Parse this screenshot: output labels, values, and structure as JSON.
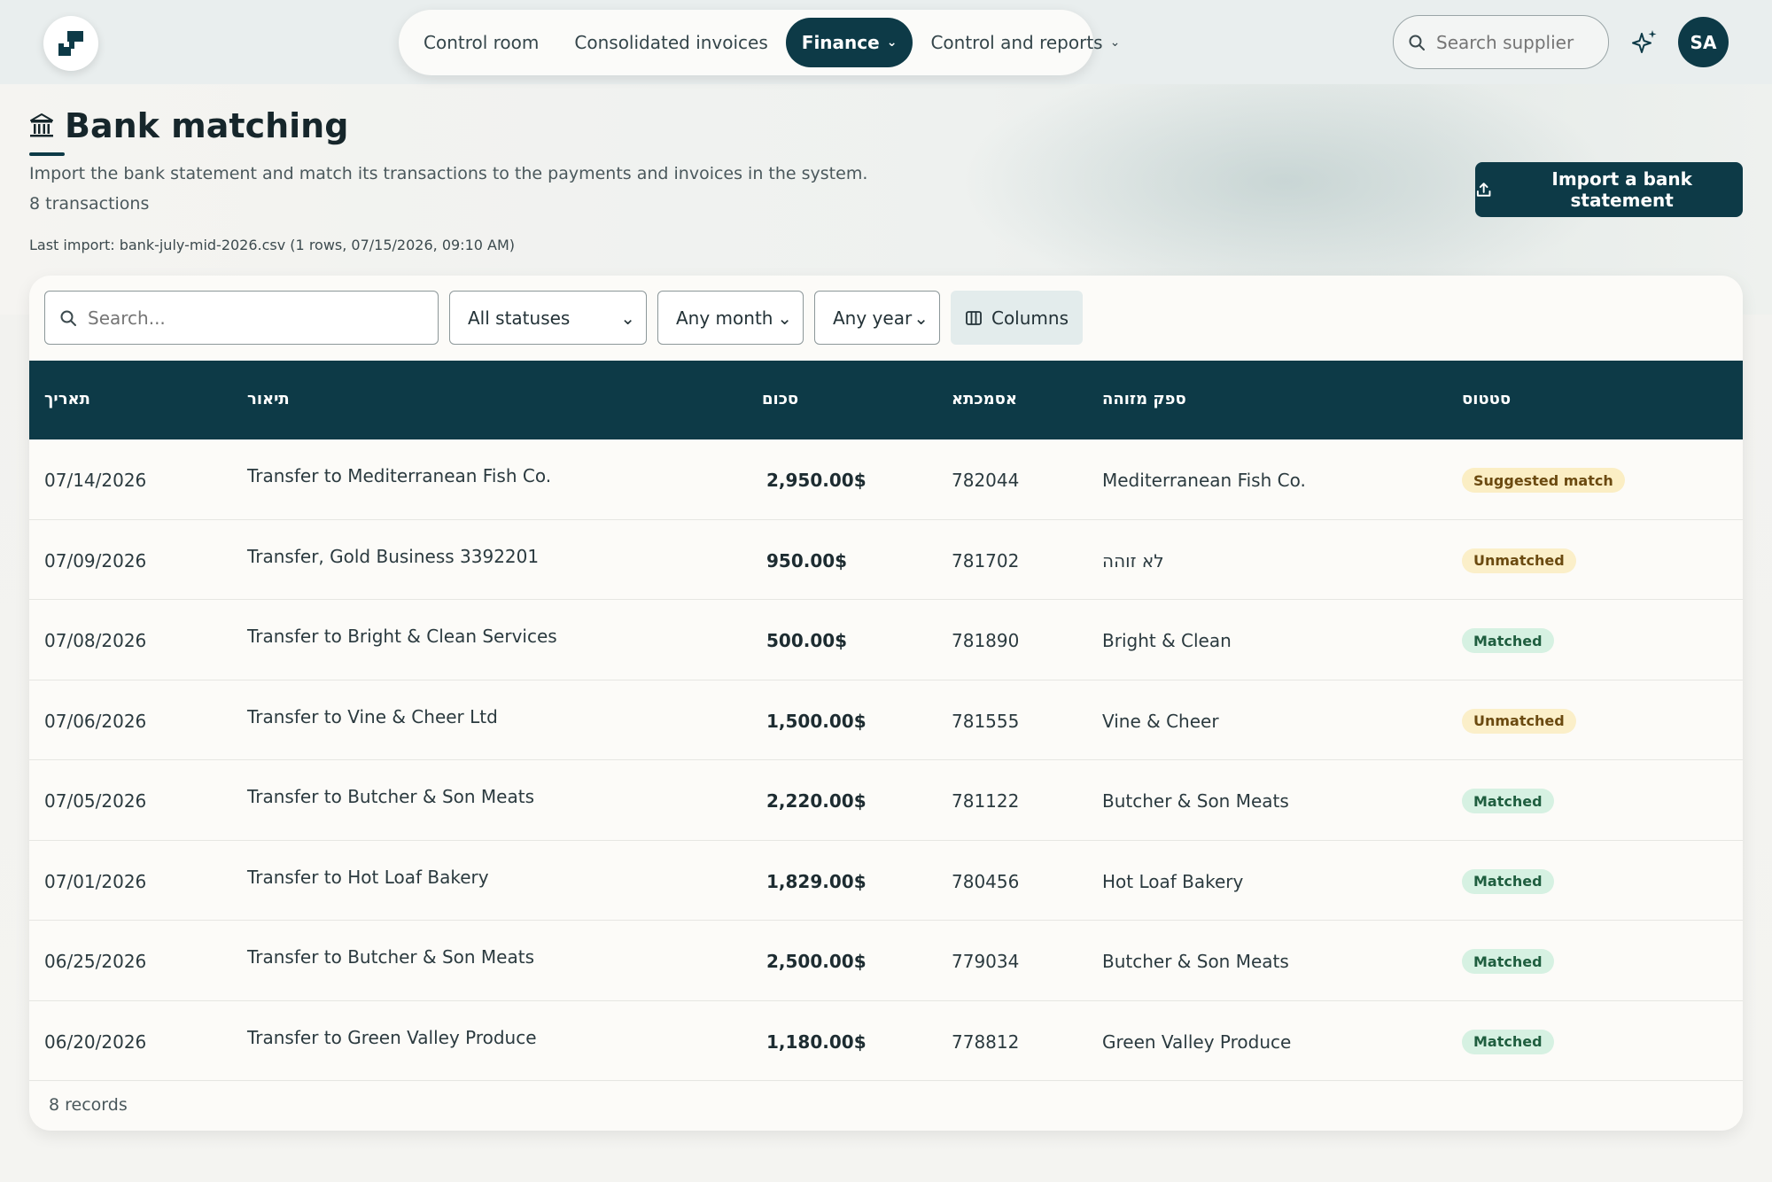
{
  "nav": {
    "items": [
      {
        "label": "Control room"
      },
      {
        "label": "Consolidated invoices"
      },
      {
        "label": "Finance"
      },
      {
        "label": "Control and reports"
      }
    ]
  },
  "header": {
    "search_placeholder": "Search supplier",
    "avatar_initials": "SA"
  },
  "page": {
    "title": "Bank matching",
    "subtitle": "Import the bank statement and match its transactions to the payments and invoices in the system.",
    "transaction_count": "8 transactions",
    "last_import": "Last import: bank-july-mid-2026.csv (1 rows, 07/15/2026, 09:10 AM)",
    "import_button": "Import a bank statement"
  },
  "filters": {
    "search_placeholder": "Search...",
    "status": "All statuses",
    "month": "Any month",
    "year": "Any year",
    "columns_label": "Columns"
  },
  "table": {
    "headers": {
      "date": "תאריך",
      "description": "תיאור",
      "amount": "סכום",
      "reference": "אסמכתא",
      "supplier": "ספק מזוהה",
      "status": "סטטוס"
    },
    "rows": [
      {
        "date": "07/14/2026",
        "description": "Transfer to Mediterranean Fish Co.",
        "amount": "2,950.00$",
        "reference": "782044",
        "supplier": "Mediterranean Fish Co.",
        "status": "Suggested match",
        "status_type": "suggested"
      },
      {
        "date": "07/09/2026",
        "description": "Transfer, Gold Business 3392201",
        "amount": "950.00$",
        "reference": "781702",
        "supplier": "לא זוהה",
        "status": "Unmatched",
        "status_type": "unmatched"
      },
      {
        "date": "07/08/2026",
        "description": "Transfer to Bright & Clean Services",
        "amount": "500.00$",
        "reference": "781890",
        "supplier": "Bright & Clean",
        "status": "Matched",
        "status_type": "matched"
      },
      {
        "date": "07/06/2026",
        "description": "Transfer to Vine & Cheer Ltd",
        "amount": "1,500.00$",
        "reference": "781555",
        "supplier": "Vine & Cheer",
        "status": "Unmatched",
        "status_type": "unmatched"
      },
      {
        "date": "07/05/2026",
        "description": "Transfer to Butcher & Son Meats",
        "amount": "2,220.00$",
        "reference": "781122",
        "supplier": "Butcher & Son Meats",
        "status": "Matched",
        "status_type": "matched"
      },
      {
        "date": "07/01/2026",
        "description": "Transfer to Hot Loaf Bakery",
        "amount": "1,829.00$",
        "reference": "780456",
        "supplier": "Hot Loaf Bakery",
        "status": "Matched",
        "status_type": "matched"
      },
      {
        "date": "06/25/2026",
        "description": "Transfer to Butcher & Son Meats",
        "amount": "2,500.00$",
        "reference": "779034",
        "supplier": "Butcher & Son Meats",
        "status": "Matched",
        "status_type": "matched"
      },
      {
        "date": "06/20/2026",
        "description": "Transfer to Green Valley Produce",
        "amount": "1,180.00$",
        "reference": "778812",
        "supplier": "Green Valley Produce",
        "status": "Matched",
        "status_type": "matched"
      }
    ],
    "footer": "8 records"
  },
  "colors": {
    "primary": "#0d3a47",
    "matched_bg": "#d6f1e2",
    "unmatched_bg": "#fbefc9"
  }
}
